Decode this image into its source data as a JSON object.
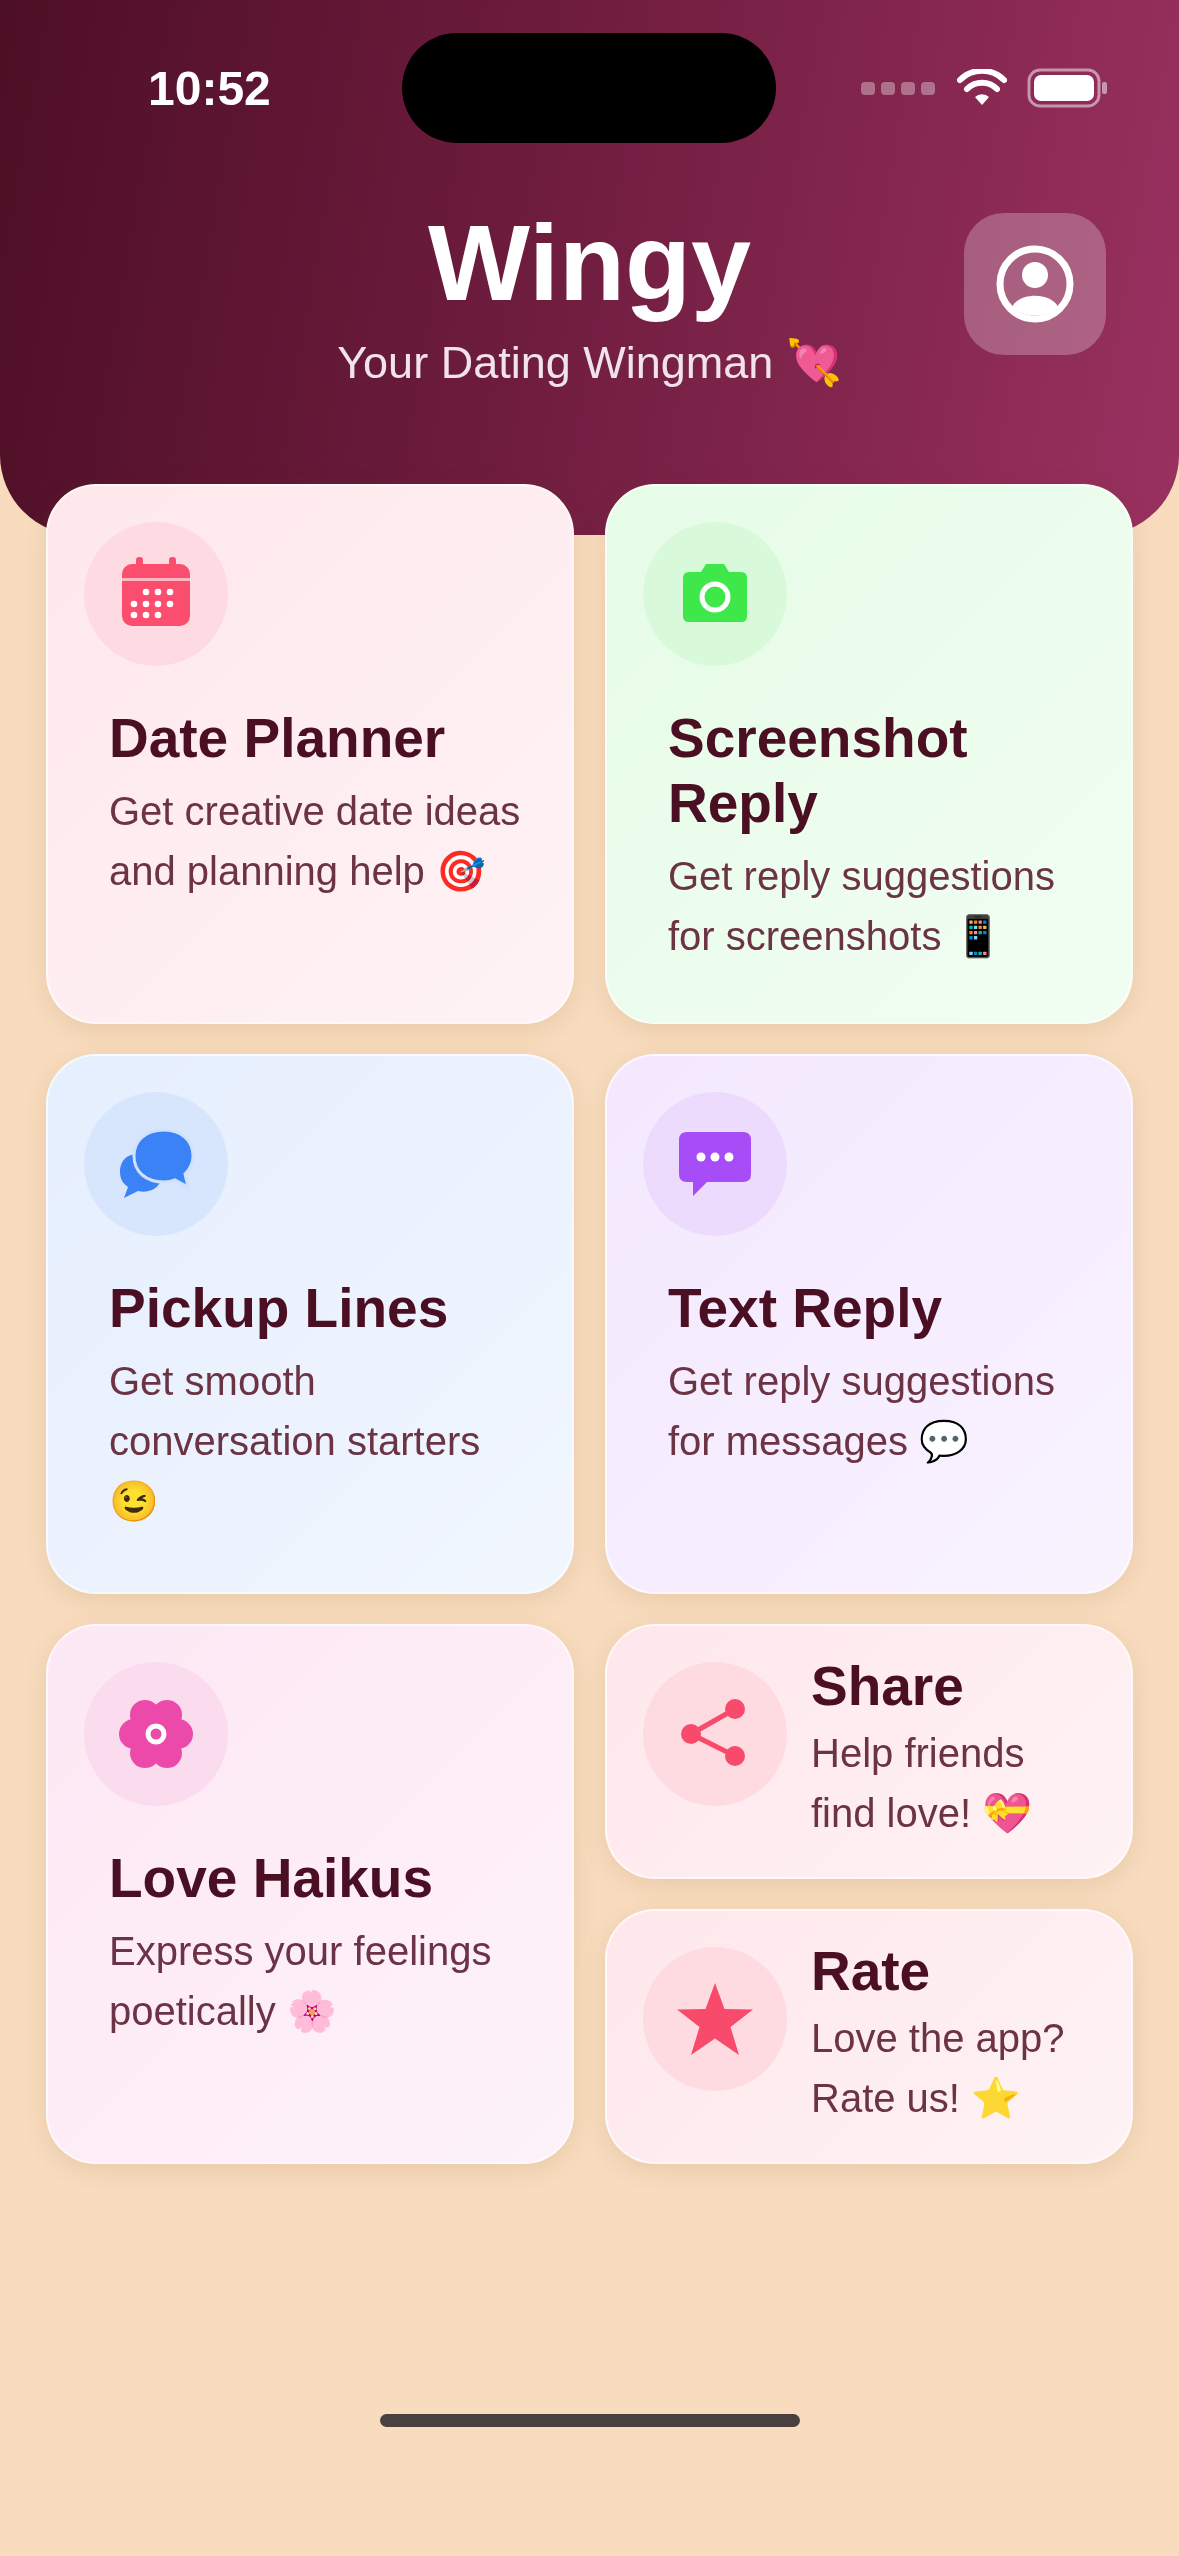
{
  "status_bar": {
    "time": "10:52"
  },
  "header": {
    "title": "Wingy",
    "subtitle": "Your Dating Wingman 💘"
  },
  "cards": [
    {
      "kind": "large",
      "color": "#fb4d6d",
      "title": "Date Planner",
      "description": "Get creative date ideas and planning help 🎯"
    },
    {
      "kind": "large",
      "color": "#3ee84a",
      "title": "Screenshot Reply",
      "description": "Get reply suggestions for screenshots 📱"
    },
    {
      "kind": "large",
      "color": "#3b82f6",
      "title": "Pickup Lines",
      "description": "Get smooth conversation starters 😉"
    },
    {
      "kind": "large",
      "color": "#a64df7",
      "title": "Text Reply",
      "description": "Get reply suggestions for messages 💬"
    },
    {
      "kind": "large",
      "color": "#ec4aaa",
      "title": "Love Haikus",
      "description": "Express your feelings poetically 🌸"
    },
    {
      "kind": "small",
      "color": "#f84a6b",
      "title": "Share",
      "description": "Help friends find love! 💝"
    },
    {
      "kind": "small",
      "color": "#f84a6b",
      "title": "Rate",
      "description": "Love the app? Rate us! ⭐"
    }
  ]
}
